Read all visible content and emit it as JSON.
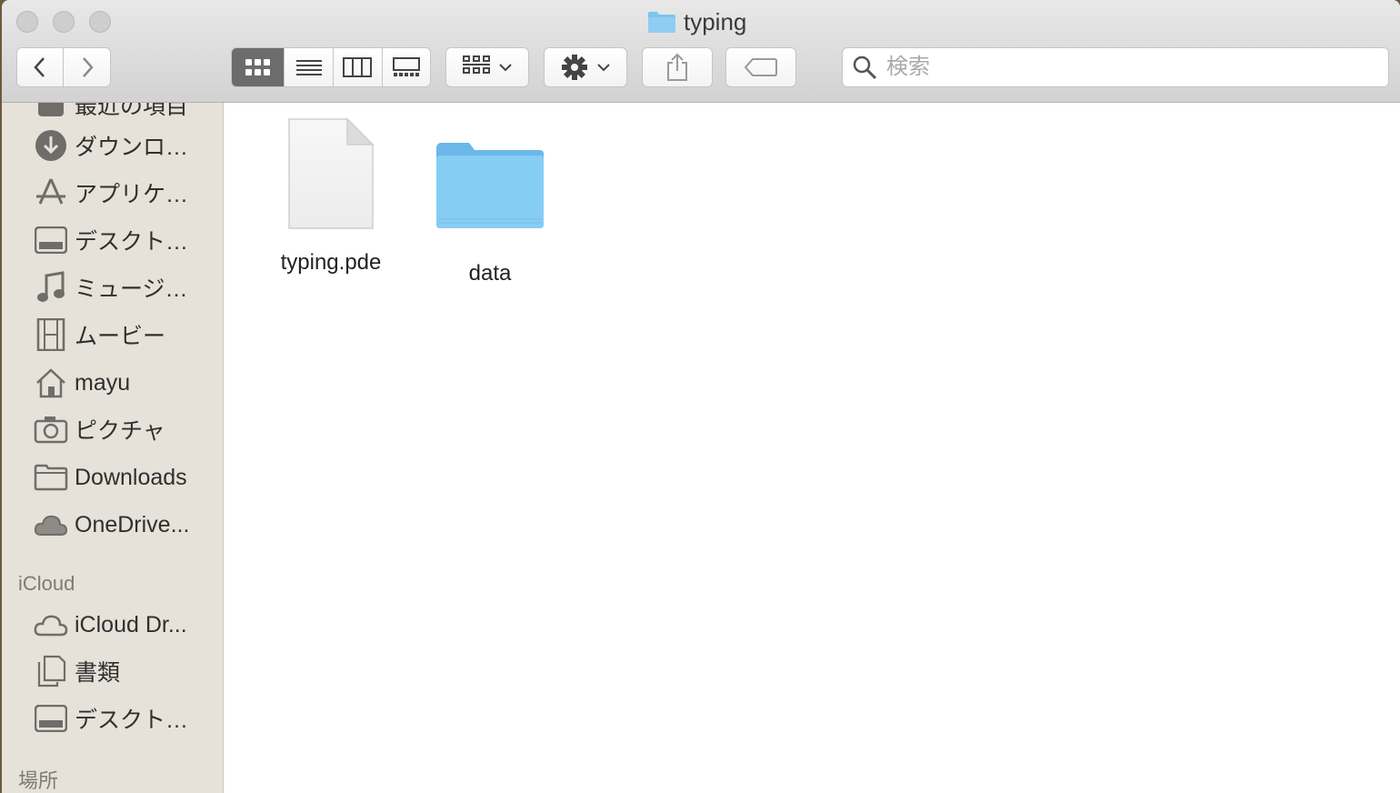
{
  "window": {
    "title": "typing"
  },
  "toolbar": {
    "back_icon": "chevron-left-icon",
    "forward_icon": "chevron-right-icon",
    "view_modes": [
      "icon-view",
      "list-view",
      "column-view",
      "gallery-view"
    ],
    "active_view": "icon-view",
    "group_icon": "grid-group-icon",
    "action_icon": "gear-icon",
    "share_icon": "share-icon",
    "tag_icon": "tag-icon"
  },
  "search": {
    "placeholder": "検索",
    "value": ""
  },
  "sidebar": {
    "partial_item": {
      "label": "最近の項目",
      "icon": "recents-icon"
    },
    "items": [
      {
        "label": "ダウンロ…",
        "icon": "download-icon"
      },
      {
        "label": "アプリケ…",
        "icon": "applications-icon"
      },
      {
        "label": "デスクト…",
        "icon": "desktop-icon"
      },
      {
        "label": "ミュージ…",
        "icon": "music-icon"
      },
      {
        "label": "ムービー",
        "icon": "movie-icon"
      },
      {
        "label": "mayu",
        "icon": "home-icon"
      },
      {
        "label": "ピクチャ",
        "icon": "camera-icon"
      },
      {
        "label": "Downloads",
        "icon": "folder-icon"
      },
      {
        "label": "OneDrive...",
        "icon": "cloud-icon"
      }
    ],
    "icloud_header": "iCloud",
    "icloud_items": [
      {
        "label": "iCloud Dr...",
        "icon": "icloud-icon"
      },
      {
        "label": "書類",
        "icon": "documents-icon"
      },
      {
        "label": "デスクト…",
        "icon": "desktop-icon"
      }
    ],
    "places_header": "場所"
  },
  "files": [
    {
      "name": "typing.pde",
      "kind": "document-icon"
    },
    {
      "name": "data",
      "kind": "folder-icon"
    }
  ],
  "colors": {
    "folder": "#7cc4ef",
    "accent_active_view": "#6d6c6d",
    "sidebar_bg": "#e6e2da"
  }
}
